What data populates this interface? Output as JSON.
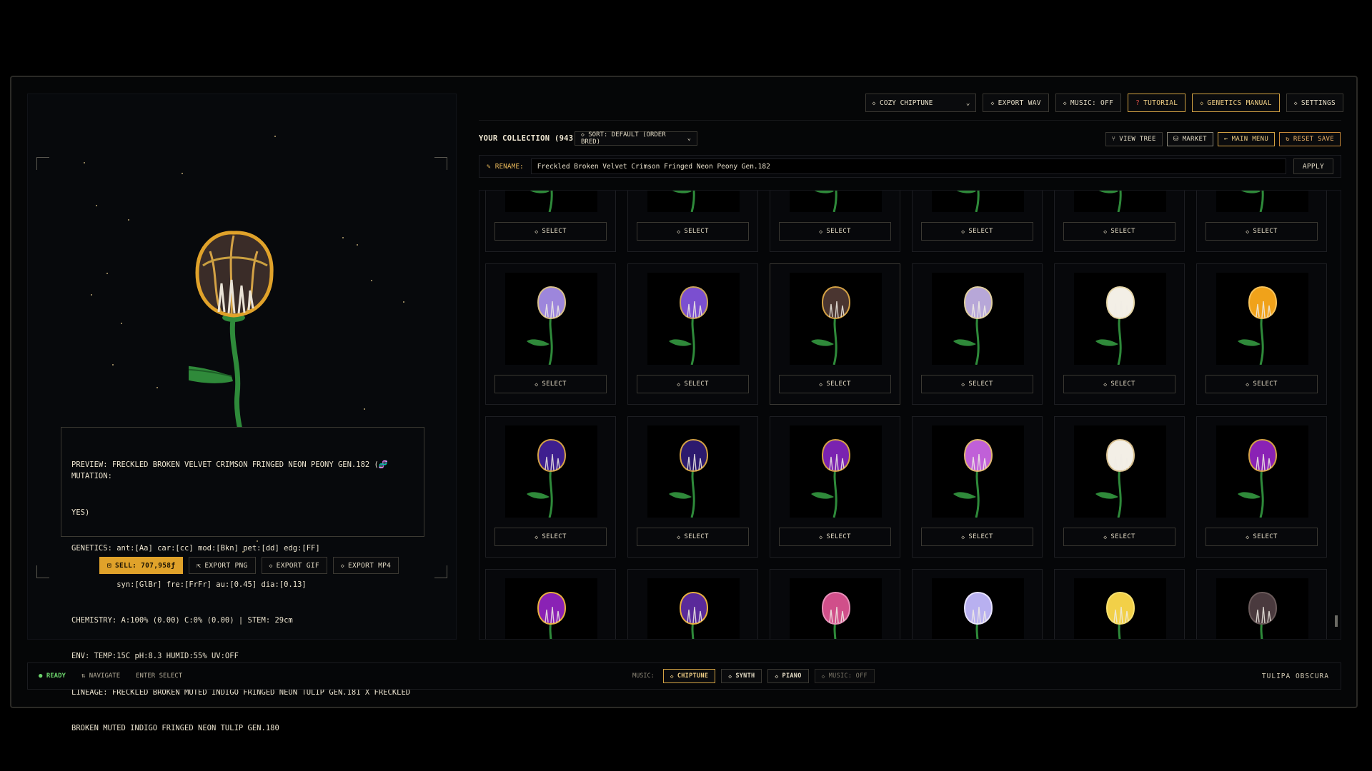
{
  "preview": {
    "info_lines": [
      "PREVIEW: FRECKLED BROKEN VELVET CRIMSON FRINGED NEON PEONY GEN.182 (🧬 MUTATION:",
      "YES)",
      "GENETICS: ant:[Aa] car:[cc] mod:[Bkn] pet:[dd] edg:[FF]",
      "          syn:[GlBr] fre:[FrFr] au:[0.45] dia:[0.13]",
      "CHEMISTRY: A:100% (0.00) C:0% (0.00) | STEM: 29cm",
      "ENV: TEMP:15C pH:8.3 HUMID:55% UV:OFF",
      "LINEAGE: FRECKLED BROKEN MUTED INDIGO FRINGED NEON TULIP GEN.181 X FRECKLED",
      "BROKEN MUTED INDIGO FRINGED NEON TULIP GEN.180"
    ],
    "sell_label": "SELL: 707,958ƒ",
    "export_png": "EXPORT PNG",
    "export_gif": "EXPORT GIF",
    "export_mp4": "EXPORT MP4"
  },
  "topbar": {
    "music_select": "COZY CHIPTUNE",
    "export_wav": "EXPORT WAV",
    "music_toggle": "MUSIC: OFF",
    "tutorial": "TUTORIAL",
    "genetics_manual": "GENETICS MANUAL",
    "settings": "SETTINGS"
  },
  "collection": {
    "title": "YOUR COLLECTION (943)",
    "sort": "SORT: DEFAULT (ORDER BRED)",
    "view_tree": "VIEW TREE",
    "market": "MARKET",
    "main_menu": "MAIN MENU",
    "reset_save": "RESET SAVE"
  },
  "rename": {
    "label": "RENAME:",
    "value": "Freckled Broken Velvet Crimson Fringed Neon Peony Gen.182",
    "apply": "APPLY"
  },
  "grid": {
    "select_label": "SELECT",
    "cards": [
      {
        "color": "#6a3fb0",
        "edge": "#caa25a"
      },
      {
        "color": "#6a3fb0",
        "edge": "#caa25a"
      },
      {
        "color": "#6a3fb0",
        "edge": "#caa25a"
      },
      {
        "color": "#6a3fb0",
        "edge": "#caa25a"
      },
      {
        "color": "#9a3fb0",
        "edge": "#caa25a"
      },
      {
        "color": "#6a3fb0",
        "edge": "#caa25a"
      },
      {
        "color": "#9d86dc",
        "edge": "#d8c08a"
      },
      {
        "color": "#7b4fd0",
        "edge": "#c8a35a"
      },
      {
        "color": "#4a3530",
        "edge": "#d4a245"
      },
      {
        "color": "#b7a7d8",
        "edge": "#e0cfa0"
      },
      {
        "color": "#f3efe6",
        "edge": "#e6d6a8"
      },
      {
        "color": "#f0a21a",
        "edge": "#f7c25a"
      },
      {
        "color": "#3e1f8f",
        "edge": "#d4a245"
      },
      {
        "color": "#2c1a6e",
        "edge": "#d4a245"
      },
      {
        "color": "#7a22b0",
        "edge": "#d4a245"
      },
      {
        "color": "#c060d8",
        "edge": "#e0b870"
      },
      {
        "color": "#f3efe6",
        "edge": "#d8c090"
      },
      {
        "color": "#8a22b5",
        "edge": "#d4a245"
      },
      {
        "color": "#8a22b5",
        "edge": "#e8b040"
      },
      {
        "color": "#5a2a9a",
        "edge": "#e8b040"
      },
      {
        "color": "#d04f8a",
        "edge": "#e88fb8"
      },
      {
        "color": "#b8b0f0",
        "edge": "#e8e4ff"
      },
      {
        "color": "#f2d048",
        "edge": "#f7e070"
      },
      {
        "color": "#4a3a3e",
        "edge": "#6a5a5a"
      }
    ]
  },
  "statusbar": {
    "ready": "READY",
    "navigate": "⇅ NAVIGATE",
    "enter_select": "ENTER SELECT",
    "music_label": "MUSIC:",
    "chiptune": "CHIPTUNE",
    "synth": "SYNTH",
    "piano": "PIANO",
    "music_off": "MUSIC: OFF",
    "brand": "TULIPA OBSCURA"
  },
  "colors": {
    "accent_gold": "#e0a22a",
    "ready_green": "#6bd36b"
  }
}
